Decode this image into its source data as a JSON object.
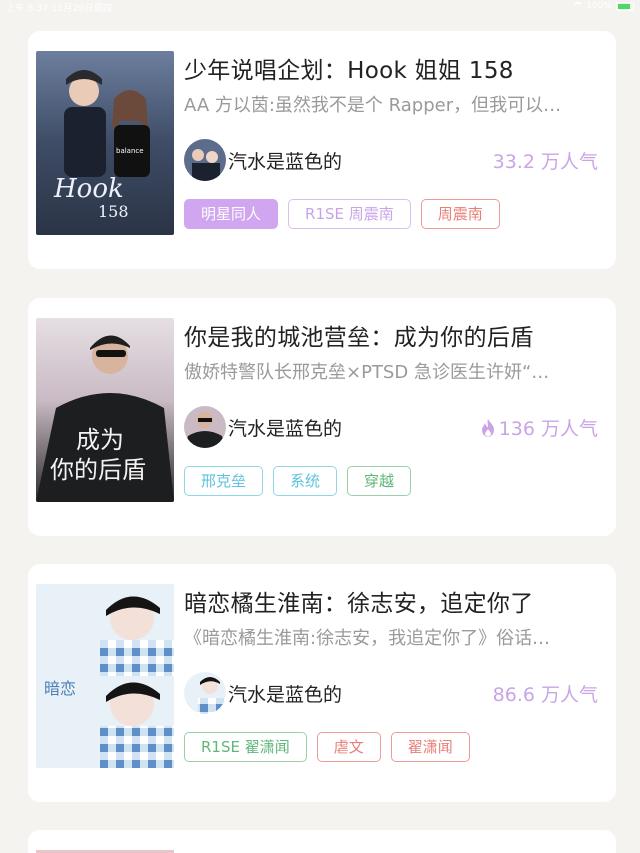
{
  "status_bar": {
    "left": "上午 8:37  11月29日周四",
    "battery": "100%"
  },
  "colors": {
    "background": "#f4f3f0",
    "popularity": "#c9a5e8",
    "tag_filled": "#cfa6ef"
  },
  "books": [
    {
      "title": "少年说唱企划：Hook 姐姐 158",
      "description": "AA 方以茵:虽然我不是个 Rapper，但我可以…",
      "author": "汽水是蓝色的",
      "popularity": "33.2 万人气",
      "hot": false,
      "tags": [
        "明星同人",
        "R1SE 周震南",
        "周震南"
      ]
    },
    {
      "title": "你是我的城池营垒：成为你的后盾",
      "description": "傲娇特警队长邢克垒×PTSD 急诊医生许妍“…",
      "author": "汽水是蓝色的",
      "popularity": "136 万人气",
      "hot": true,
      "tags": [
        "邢克垒",
        "系统",
        "穿越"
      ]
    },
    {
      "title": "暗恋橘生淮南：徐志安，追定你了",
      "description": "《暗恋橘生淮南:徐志安，我追定你了》俗话…",
      "author": "汽水是蓝色的",
      "popularity": "86.6 万人气",
      "hot": false,
      "tags": [
        "R1SE 翟潇闻",
        "虐文",
        "翟潇闻"
      ]
    }
  ]
}
